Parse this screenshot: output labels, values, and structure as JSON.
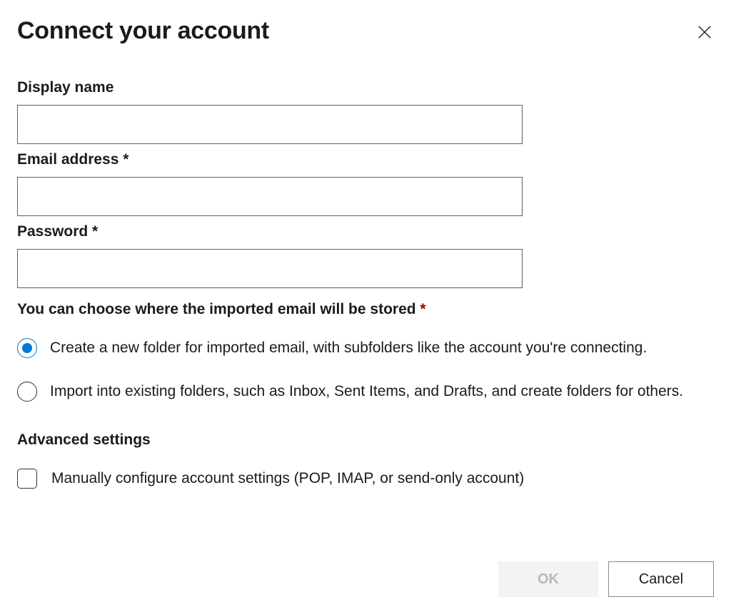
{
  "dialog": {
    "title": "Connect your account"
  },
  "fields": {
    "display_name": {
      "label": "Display name",
      "value": ""
    },
    "email": {
      "label": "Email address *",
      "value": ""
    },
    "password": {
      "label": "Password *",
      "value": ""
    }
  },
  "storage": {
    "heading_text": "You can choose where the imported email will be stored ",
    "heading_asterisk": "*",
    "options": {
      "new_folder": "Create a new folder for imported email, with subfolders like the account you're connecting.",
      "existing_folders": "Import into existing folders, such as Inbox, Sent Items, and Drafts, and create folders for others."
    },
    "selected": "new_folder"
  },
  "advanced": {
    "heading": "Advanced settings",
    "manual_config_label": "Manually configure account settings (POP, IMAP, or send-only account)",
    "manual_config_checked": false
  },
  "buttons": {
    "ok": "OK",
    "cancel": "Cancel"
  }
}
